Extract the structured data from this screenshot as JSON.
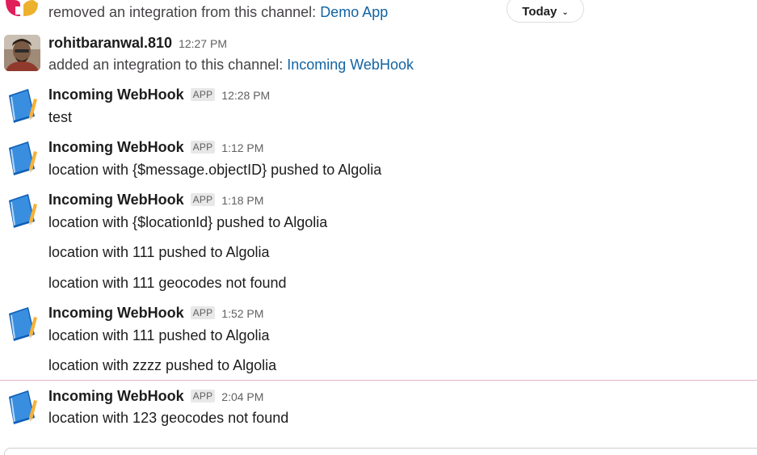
{
  "day_divider": {
    "label": "Today"
  },
  "messages": [
    {
      "kind": "system-continued",
      "text": "removed an integration from this channel: ",
      "link": "Demo App"
    },
    {
      "kind": "user",
      "sender": "rohitbaranwal.810",
      "time": "12:27 PM",
      "text": "added an integration to this channel: ",
      "link": "Incoming WebHook"
    },
    {
      "kind": "app",
      "sender": "Incoming WebHook",
      "badge": "APP",
      "time": "12:28 PM",
      "lines": [
        "test"
      ]
    },
    {
      "kind": "app",
      "sender": "Incoming WebHook",
      "badge": "APP",
      "time": "1:12 PM",
      "lines": [
        "location with {$message.objectID} pushed to Algolia"
      ]
    },
    {
      "kind": "app",
      "sender": "Incoming WebHook",
      "badge": "APP",
      "time": "1:18 PM",
      "lines": [
        "location with {$locationId} pushed to Algolia",
        "location with 111 pushed to Algolia",
        "location with 111 geocodes not found"
      ]
    },
    {
      "kind": "app",
      "sender": "Incoming WebHook",
      "badge": "APP",
      "time": "1:52 PM",
      "lines": [
        "location with 111 pushed to Algolia",
        "location with zzzz pushed to Algolia"
      ]
    },
    {
      "kind": "app",
      "sender": "Incoming WebHook",
      "badge": "APP",
      "time": "2:04 PM",
      "lines": [
        "location with 123 geocodes not found"
      ]
    }
  ],
  "icons": {
    "app_avatar": "blue-notebook-pencil-icon",
    "user_avatar": "user-photo-avatar",
    "partial_avatar": "colorful-app-logo-icon",
    "day_chevron": "chevron-down-icon"
  }
}
